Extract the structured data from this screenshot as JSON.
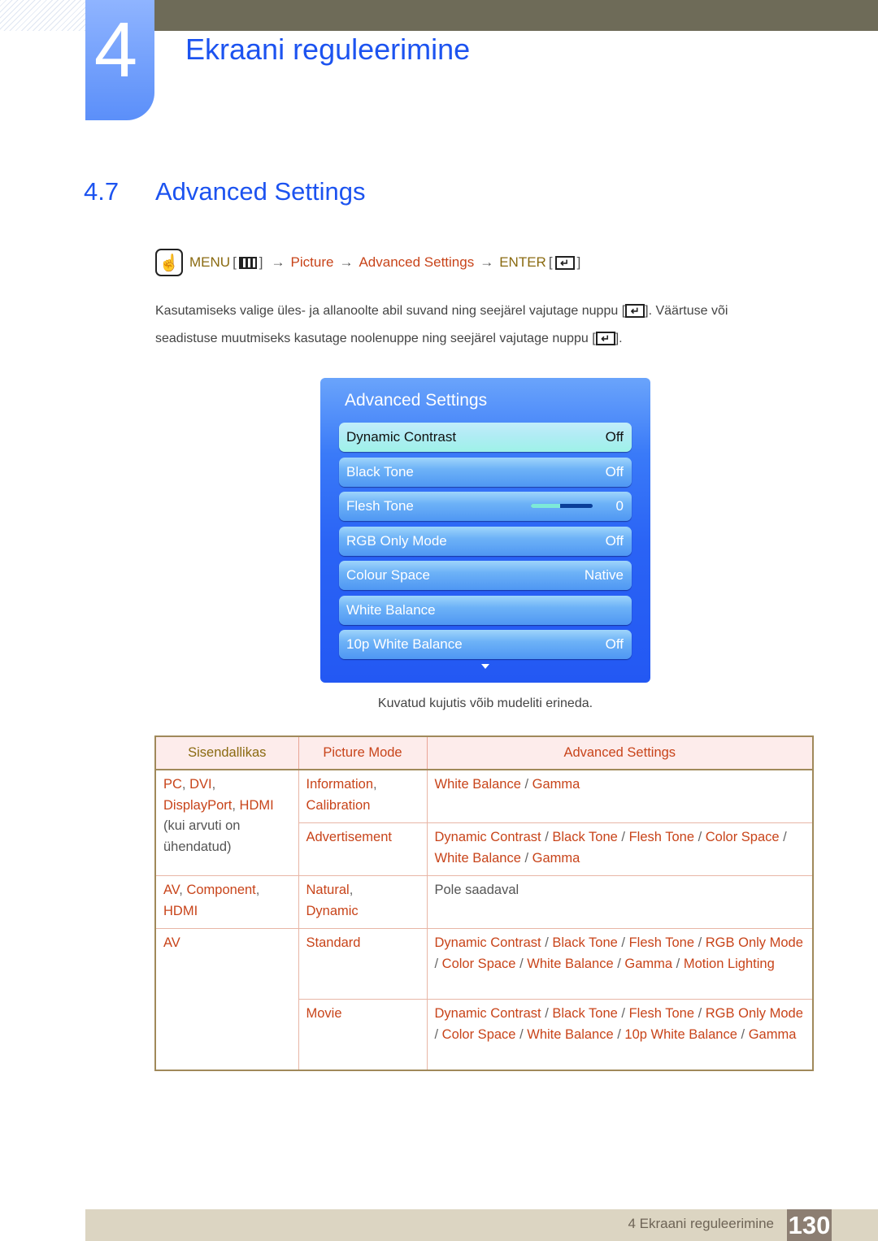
{
  "chapter": {
    "number": "4",
    "title": "Ekraani reguleerimine"
  },
  "section": {
    "number": "4.7",
    "title": "Advanced Settings"
  },
  "nav_path": {
    "icon": "touch-hand-icon",
    "menu_label": "MENU",
    "menu_icon": "menu-icon",
    "arrow": "→",
    "steps": [
      "Picture",
      "Advanced Settings"
    ],
    "enter_label": "ENTER",
    "enter_icon": "enter-icon"
  },
  "instructions": {
    "line1_before": "Kasutamiseks valige üles- ja allanoolte abil suvand ning seejärel vajutage nuppu [",
    "line1_after": "]. Väärtuse või",
    "line2_before": "seadistuse muutmiseks kasutage noolenuppe ning seejärel vajutage nuppu [",
    "line2_after": "]."
  },
  "osd": {
    "title": "Advanced Settings",
    "items": [
      {
        "label": "Dynamic Contrast",
        "value": "Off",
        "selected": true
      },
      {
        "label": "Black Tone",
        "value": "Off"
      },
      {
        "label": "Flesh Tone",
        "value": "0",
        "slider_fraction": 0.47
      },
      {
        "label": "RGB Only Mode",
        "value": "Off"
      },
      {
        "label": "Colour Space",
        "value": "Native"
      },
      {
        "label": "White Balance",
        "value": ""
      },
      {
        "label": "10p White Balance",
        "value": "Off"
      }
    ],
    "scroll_icon": "scroll-down-icon"
  },
  "caption": "Kuvatud kujutis võib mudeliti erineda.",
  "table": {
    "headers": [
      "Sisendallikas",
      "Picture Mode",
      "Advanced Settings"
    ],
    "source_groups": [
      {
        "source": [
          "PC",
          "DVI",
          "DisplayPort",
          "HDMI"
        ],
        "source_note": "(kui arvuti on ühendatud)",
        "modes": [
          {
            "mode": [
              "Information",
              "Calibration"
            ],
            "settings": [
              "White Balance",
              "Gamma"
            ]
          },
          {
            "mode": [
              "Advertisement"
            ],
            "settings": [
              "Dynamic Contrast",
              "Black Tone",
              "Flesh Tone",
              "Color Space",
              "White Balance",
              "Gamma"
            ]
          }
        ]
      },
      {
        "source": [
          "AV",
          "Component",
          "HDMI"
        ],
        "modes": [
          {
            "mode": [
              "Natural",
              "Dynamic"
            ],
            "settings_text": "Pole saadaval"
          }
        ]
      },
      {
        "source": [
          "AV"
        ],
        "modes": [
          {
            "mode": [
              "Standard"
            ],
            "settings": [
              "Dynamic Contrast",
              "Black Tone",
              "Flesh Tone",
              "RGB Only Mode",
              "Color Space",
              "White Balance",
              "Gamma",
              "Motion Lighting"
            ]
          },
          {
            "mode": [
              "Movie"
            ],
            "settings": [
              "Dynamic Contrast",
              "Black Tone",
              "Flesh Tone",
              "RGB Only Mode",
              "Color Space",
              "White Balance",
              "10p White Balance",
              "Gamma"
            ]
          }
        ]
      }
    ]
  },
  "footer": {
    "label": "4 Ekraani reguleerimine",
    "page": "130"
  },
  "colors": {
    "heading_blue": "#1c53f0",
    "gold": "#8a6a10",
    "red": "#c8441a",
    "osd_blue": "#2358f3"
  }
}
